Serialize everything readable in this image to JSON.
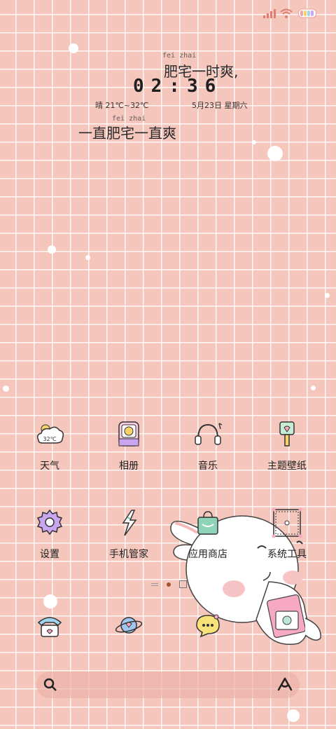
{
  "status": {
    "icons": [
      "signal-icon",
      "wifi-icon",
      "battery-icon"
    ]
  },
  "widget": {
    "pinyin_top": "fei zhai",
    "lyric_line1": "肥宅一时爽,",
    "time": "02:36",
    "weather": "晴 21℃~32℃",
    "date": "5月23日 星期六",
    "pinyin_bottom": "fei zhai",
    "lyric_line2": "一直肥宅一直爽"
  },
  "apps_row1": [
    {
      "label": "天气",
      "icon": "weather-cloud-icon",
      "badge": "32℃"
    },
    {
      "label": "相册",
      "icon": "gallery-icon"
    },
    {
      "label": "音乐",
      "icon": "headphones-icon"
    },
    {
      "label": "主题壁纸",
      "icon": "theme-brush-icon"
    }
  ],
  "apps_row2": [
    {
      "label": "设置",
      "icon": "gear-icon"
    },
    {
      "label": "手机管家",
      "icon": "lightning-icon"
    },
    {
      "label": "应用商店",
      "icon": "shopping-bag-icon"
    },
    {
      "label": "系统工具",
      "icon": "tools-folder-icon"
    }
  ],
  "dock": [
    {
      "icon": "phone-icon"
    },
    {
      "icon": "planet-icon"
    },
    {
      "icon": "chat-bubble-icon"
    },
    {
      "icon": "camera-icon"
    }
  ],
  "page_indicator": {
    "pages": 3,
    "current": 2
  },
  "search": {
    "icons": [
      "search-icon",
      "assistant-icon"
    ]
  },
  "colors": {
    "background": "#f4c6bc",
    "grid": "#ffffff",
    "accent_dot": "#a0522d"
  }
}
